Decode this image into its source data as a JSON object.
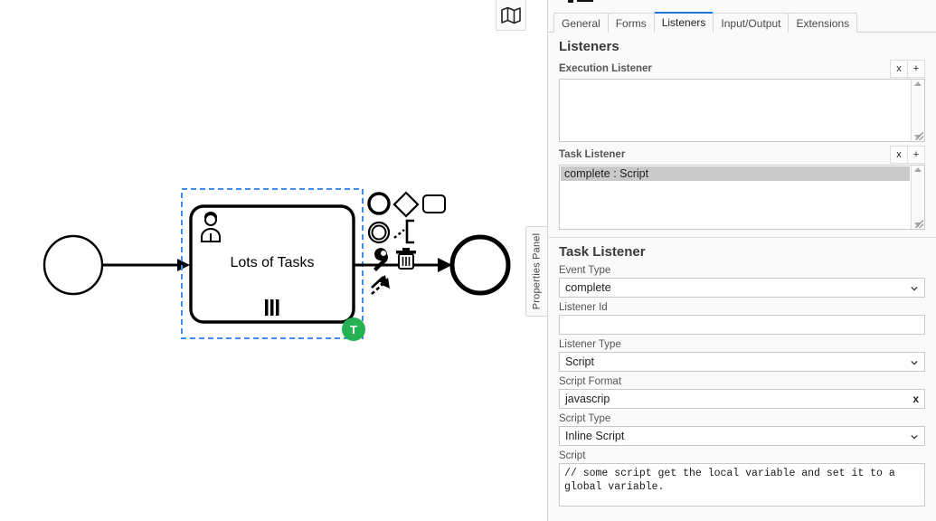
{
  "canvas": {
    "minimap_button_icon": "map-icon",
    "start_event_name": "start-event",
    "task": {
      "label": "Lots of Tasks",
      "type_icon": "user-task-icon",
      "marker": "parallel-multi-instance-marker",
      "badge_label": "T",
      "badge_color": "#26b254",
      "selected": true,
      "selection_color": "#3f8cf4"
    },
    "end_event_name": "end-event",
    "context_pad": [
      {
        "name": "append-end-event",
        "icon": "circle-thick-icon"
      },
      {
        "name": "append-gateway",
        "icon": "diamond-icon"
      },
      {
        "name": "append-task",
        "icon": "rounded-rect-icon"
      },
      {
        "name": "append-intermediate-event",
        "icon": "double-circle-icon"
      },
      {
        "name": "append-text-annotation",
        "icon": "bracket-icon"
      },
      {
        "name": "change-type",
        "icon": "wrench-icon"
      },
      {
        "name": "delete-element",
        "icon": "trash-icon"
      },
      {
        "name": "connect",
        "icon": "connect-arrow-icon"
      }
    ]
  },
  "panel_tab": {
    "label": "Properties Panel"
  },
  "panel": {
    "tabs": [
      {
        "label": "General",
        "active": false
      },
      {
        "label": "Forms",
        "active": false
      },
      {
        "label": "Listeners",
        "active": true
      },
      {
        "label": "Input/Output",
        "active": false
      },
      {
        "label": "Extensions",
        "active": false
      }
    ],
    "listeners_section": {
      "title": "Listeners",
      "execution_listener": {
        "label": "Execution Listener",
        "remove_label": "x",
        "add_label": "+",
        "options": []
      },
      "task_listener": {
        "label": "Task Listener",
        "remove_label": "x",
        "add_label": "+",
        "options": [
          "complete : Script"
        ],
        "selected": "complete : Script"
      }
    },
    "details_section": {
      "title": "Task Listener",
      "event_type": {
        "label": "Event Type",
        "value": "complete"
      },
      "listener_id": {
        "label": "Listener Id",
        "value": ""
      },
      "listener_type": {
        "label": "Listener Type",
        "value": "Script"
      },
      "script_format": {
        "label": "Script Format",
        "value": "javascrip",
        "clear_label": "x"
      },
      "script_type": {
        "label": "Script Type",
        "value": "Inline Script"
      },
      "script": {
        "label": "Script",
        "value": "// some script get the local variable and set it to a global variable."
      }
    }
  }
}
